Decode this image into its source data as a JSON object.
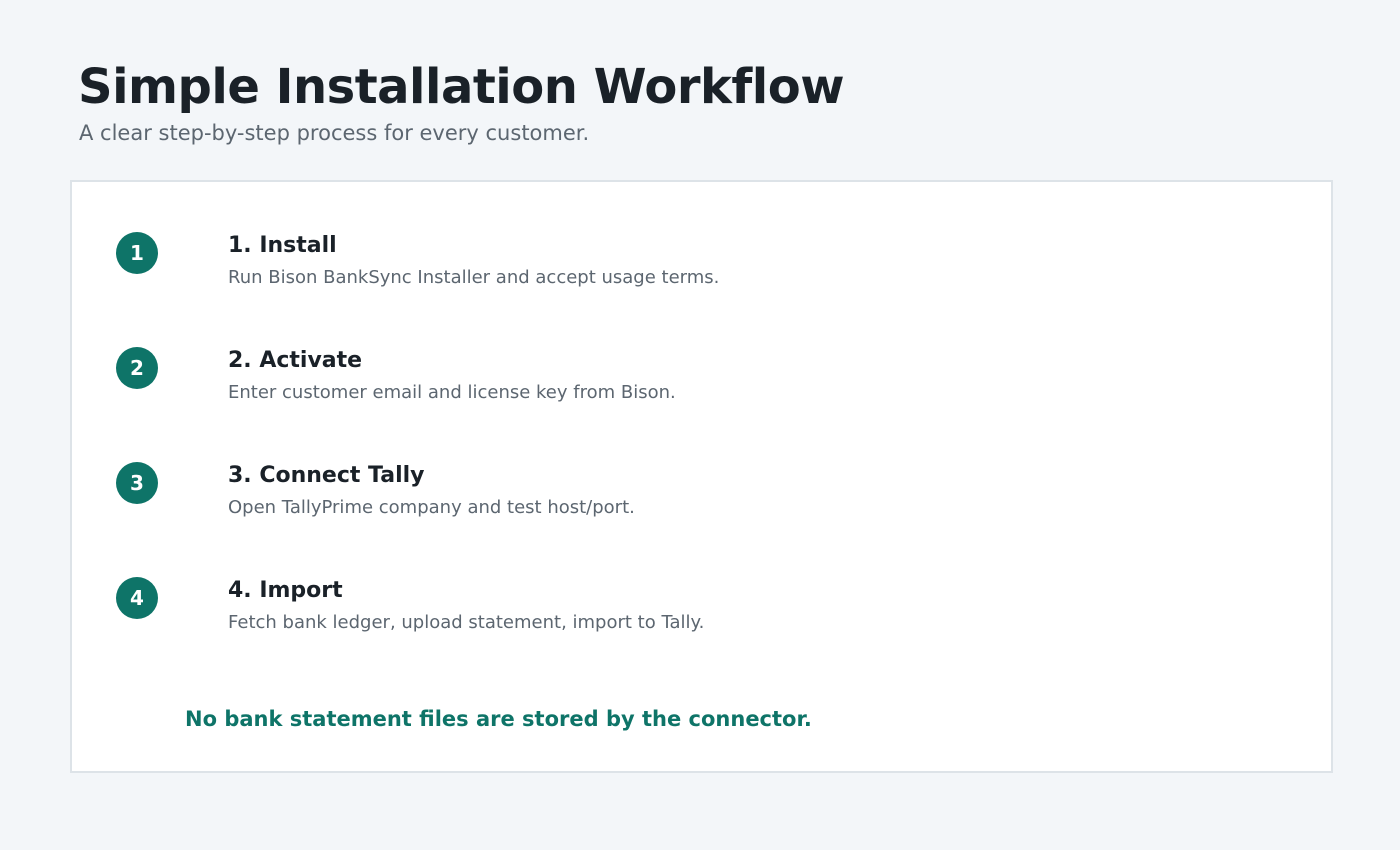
{
  "header": {
    "title": "Simple Installation Workflow",
    "subtitle": "A clear step-by-step process for every customer."
  },
  "steps": [
    {
      "number": "1",
      "title": "1. Install",
      "description": "Run Bison BankSync Installer and accept usage terms."
    },
    {
      "number": "2",
      "title": "2. Activate",
      "description": "Enter customer email and license key from Bison."
    },
    {
      "number": "3",
      "title": "3. Connect Tally",
      "description": "Open TallyPrime company and test host/port."
    },
    {
      "number": "4",
      "title": "4. Import",
      "description": "Fetch bank ledger, upload statement, import to Tally."
    }
  ],
  "footer_note": "No bank statement files are stored by the connector.",
  "colors": {
    "accent": "#0e7468",
    "background": "#f3f6f9",
    "card": "#ffffff",
    "heading": "#1a2128",
    "muted": "#5c6670",
    "border": "#dde3e8"
  }
}
